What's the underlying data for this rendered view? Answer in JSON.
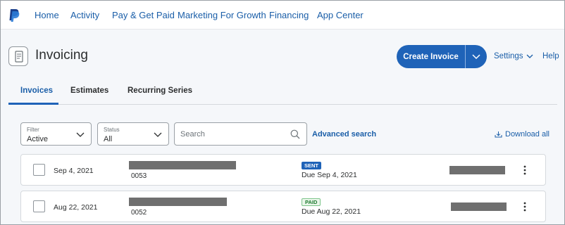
{
  "nav": {
    "items": [
      "Home",
      "Activity",
      "Pay & Get Paid",
      "Marketing For Growth",
      "Financing",
      "App Center"
    ]
  },
  "header": {
    "title": "Invoicing",
    "create_label": "Create Invoice",
    "settings_label": "Settings",
    "help_label": "Help"
  },
  "tabs": [
    "Invoices",
    "Estimates",
    "Recurring Series"
  ],
  "active_tab": "Invoices",
  "filters": {
    "filter": {
      "label": "Filter",
      "value": "Active"
    },
    "status": {
      "label": "Status",
      "value": "All"
    },
    "search_placeholder": "Search",
    "advanced_search": "Advanced search",
    "download_all": "Download all"
  },
  "invoices": [
    {
      "date": "Sep 4, 2021",
      "number": "0053",
      "status": "SENT",
      "due": "Due Sep 4, 2021"
    },
    {
      "date": "Aug 22, 2021",
      "number": "0052",
      "status": "PAID",
      "due": "Due Aug 22, 2021"
    }
  ],
  "colors": {
    "accent": "#1f63b8",
    "link": "#1a5ea8",
    "sent_badge": "#1f63b8",
    "paid_badge_text": "#1c7a2e",
    "redaction": "#6f6f6f"
  }
}
